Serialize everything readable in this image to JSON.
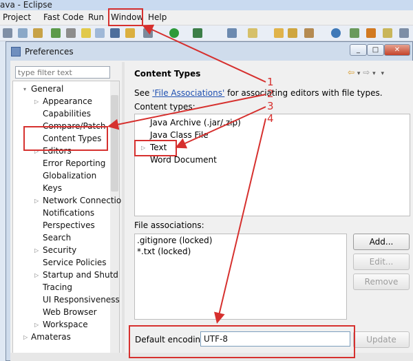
{
  "app": {
    "title": "ava - Eclipse",
    "menu": [
      "Project",
      "Fast Code",
      "Run",
      "Window",
      "Help"
    ]
  },
  "dialog": {
    "title": "Preferences",
    "minimize": "_",
    "maximize": "□",
    "close": "✕"
  },
  "filter": {
    "placeholder": "type filter text"
  },
  "tree": [
    {
      "label": "General",
      "expander": "▾",
      "level": 0
    },
    {
      "label": "Appearance",
      "expander": "▷",
      "level": 1
    },
    {
      "label": "Capabilities",
      "expander": "",
      "level": 1
    },
    {
      "label": "Compare/Patch",
      "expander": "",
      "level": 1
    },
    {
      "label": "Content Types",
      "expander": "",
      "level": 1
    },
    {
      "label": "Editors",
      "expander": "▷",
      "level": 1
    },
    {
      "label": "Error Reporting",
      "expander": "",
      "level": 1
    },
    {
      "label": "Globalization",
      "expander": "",
      "level": 1
    },
    {
      "label": "Keys",
      "expander": "",
      "level": 1
    },
    {
      "label": "Network Connectio",
      "expander": "▷",
      "level": 1
    },
    {
      "label": "Notifications",
      "expander": "",
      "level": 1
    },
    {
      "label": "Perspectives",
      "expander": "",
      "level": 1
    },
    {
      "label": "Search",
      "expander": "",
      "level": 1
    },
    {
      "label": "Security",
      "expander": "▷",
      "level": 1
    },
    {
      "label": "Service Policies",
      "expander": "",
      "level": 1
    },
    {
      "label": "Startup and Shutd",
      "expander": "▷",
      "level": 1
    },
    {
      "label": "Tracing",
      "expander": "",
      "level": 1
    },
    {
      "label": "UI Responsiveness",
      "expander": "",
      "level": 1
    },
    {
      "label": "Web Browser",
      "expander": "",
      "level": 1
    },
    {
      "label": "Workspace",
      "expander": "▷",
      "level": 1
    },
    {
      "label": "Amateras",
      "expander": "▷",
      "level": 0
    }
  ],
  "pane": {
    "title": "Content Types",
    "see_prefix": "See ",
    "see_link": "'File Associations'",
    "see_suffix": " for associating editors with file types.",
    "content_types_label": "Content types:",
    "content_types": [
      {
        "label": "Java Archive (.jar/.zip)",
        "expander": ""
      },
      {
        "label": "Java Class File",
        "expander": ""
      },
      {
        "label": "Text",
        "expander": "▷"
      },
      {
        "label": "Word Document",
        "expander": ""
      }
    ],
    "file_assoc_label": "File associations:",
    "file_associations": [
      ".gitignore (locked)",
      "*.txt (locked)"
    ],
    "buttons": {
      "add": "Add...",
      "edit": "Edit...",
      "remove": "Remove",
      "update": "Update"
    },
    "encoding_label": "Default encoding:",
    "encoding_value": "UTF-8"
  },
  "annotations": {
    "numbers": [
      "1",
      "2",
      "3",
      "4"
    ],
    "color": "#d6302e"
  }
}
